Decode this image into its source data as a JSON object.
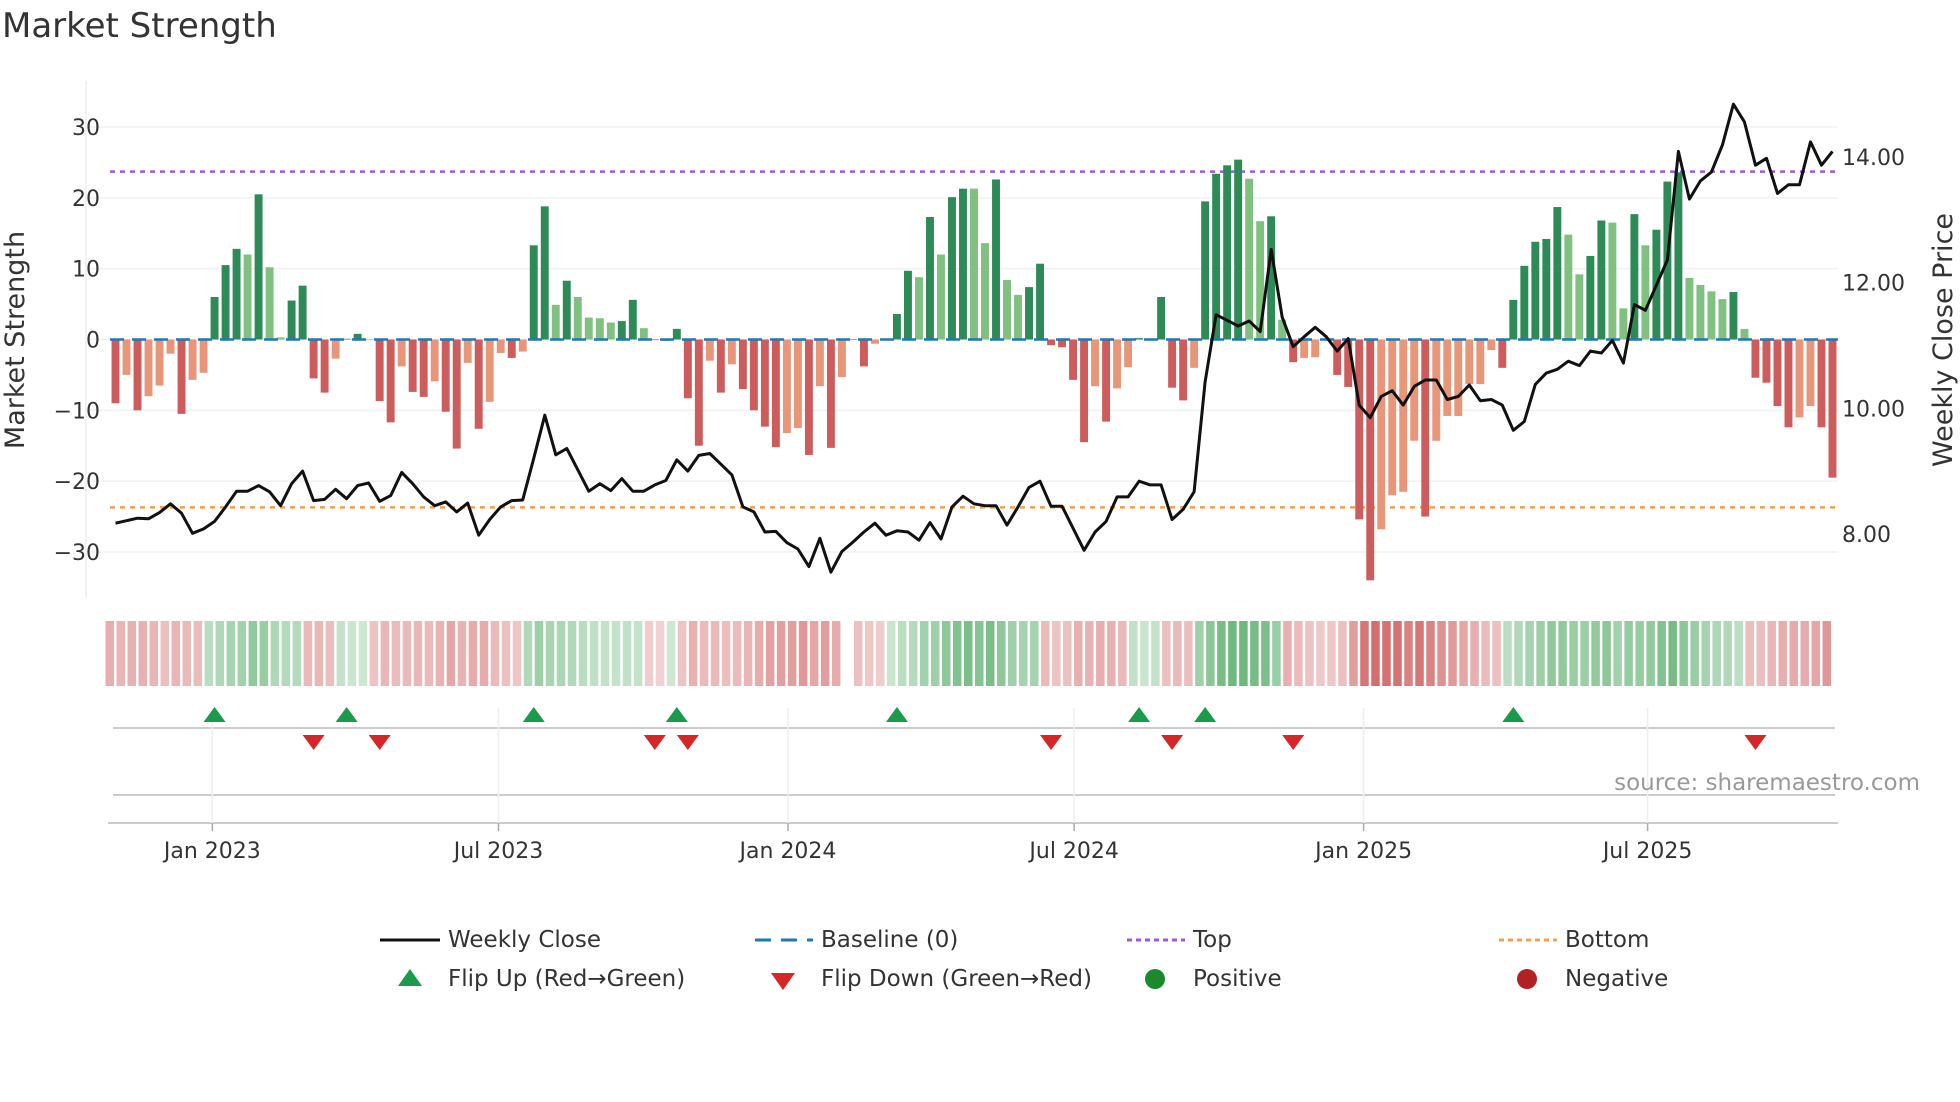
{
  "title": "Market Strength",
  "source": "source: sharemaestro.com",
  "legend": {
    "weekly_close": "Weekly Close",
    "baseline": "Baseline (0)",
    "top": "Top",
    "bottom": "Bottom",
    "flip_up": "Flip Up (Red→Green)",
    "flip_down": "Flip Down (Green→Red)",
    "positive": "Positive",
    "negative": "Negative"
  },
  "colors": {
    "pos_strong": "#2e8b57",
    "pos_weak": "#80c080",
    "neg_strong": "#cd5c5c",
    "neg_weak": "#e8967a",
    "baseline": "#1f77b4",
    "top": "#9b59e0",
    "bottom": "#f0a050",
    "price": "#111111",
    "flip_up": "#1a9a4a",
    "flip_down": "#d62728"
  },
  "chart_data": {
    "type": "bar",
    "title": "Market Strength",
    "ylabel": "Market Strength",
    "y2label": "Weekly Close Price",
    "ylim": [
      -36.5,
      36.5
    ],
    "y2lim": [
      6.98,
      15.21
    ],
    "yticks": [
      "30",
      "20",
      "10",
      "0",
      "−10",
      "−20",
      "−30"
    ],
    "ytick_values": [
      30,
      20,
      10,
      0,
      -10,
      -20,
      -30
    ],
    "y2ticks": [
      "14.00",
      "12.00",
      "10.00",
      "8.00"
    ],
    "y2tick_values": [
      14,
      12,
      10,
      8
    ],
    "xticks": [
      "Jan 2023",
      "Jul 2023",
      "Jan 2024",
      "Jul 2024",
      "Jan 2025",
      "Jul 2025"
    ],
    "xtick_weeks": [
      9.8,
      35.8,
      62.1,
      88.1,
      114.4,
      140.2
    ],
    "start_week": "2022-11-04",
    "frequency": "weekly",
    "top_level": 23.7,
    "bottom_level": -23.7,
    "baseline": 0,
    "strength": [
      -9,
      -5,
      -10,
      -8,
      -6.5,
      -2,
      -10.5,
      -5.7,
      -4.7,
      6,
      10.5,
      12.8,
      12,
      20.5,
      10.2,
      0.3,
      5.5,
      7.6,
      -5.5,
      -7.5,
      -2.7,
      0.1,
      0.8,
      0.05,
      -8.7,
      -11.7,
      -3.8,
      -7.4,
      -8.1,
      -5.9,
      -10.2,
      -15.4,
      -3.3,
      -12.6,
      -8.8,
      -1.9,
      -2.6,
      -1.7,
      13.3,
      18.8,
      4.9,
      8.3,
      6,
      3.1,
      3,
      2.4,
      2.6,
      5.6,
      1.6,
      -0.1,
      -0.2,
      1.5,
      -8.3,
      -15,
      -3,
      -7.5,
      -3.5,
      -7,
      -10,
      -12.3,
      -15.2,
      -13.2,
      -12.5,
      -16.3,
      -6.6,
      -15.3,
      -5.3,
      0,
      -3.8,
      -0.6,
      -0.1,
      3.6,
      9.7,
      8.8,
      17.3,
      12,
      20.1,
      21.3,
      21.3,
      13.6,
      22.6,
      8.4,
      6.3,
      7.4,
      10.7,
      -0.8,
      -1.1,
      -5.7,
      -14.5,
      -6.6,
      -11.6,
      -6.9,
      -3.9,
      0.2,
      0.15,
      6,
      -6.8,
      -8.6,
      -4,
      19.5,
      23.4,
      24.6,
      25.4,
      22.7,
      16.7,
      17.4,
      2.8,
      -3.2,
      -2.6,
      -2.5,
      -0.1,
      -5,
      -6.7,
      -25.4,
      -34,
      -26.8,
      -22,
      -21.5,
      -14.3,
      -25,
      -14.3,
      -10.8,
      -10.8,
      -6.3,
      -6.3,
      -1.5,
      -4,
      5.6,
      10.4,
      13.8,
      14.2,
      18.7,
      14.8,
      9.2,
      11.8,
      16.8,
      16.5,
      4.4,
      17.7,
      13.3,
      15.5,
      22.3,
      23.6,
      8.7,
      7.7,
      6.8,
      5.7,
      6.7,
      1.5,
      -5.4,
      -6.1,
      -9.4,
      -12.4,
      -11,
      -9.4,
      -12.4,
      -19.5
    ],
    "weekly_close": [
      8.17,
      8.21,
      8.25,
      8.24,
      8.34,
      8.48,
      8.33,
      8.01,
      8.08,
      8.2,
      8.43,
      8.68,
      8.68,
      8.77,
      8.67,
      8.45,
      8.8,
      9.0,
      8.53,
      8.55,
      8.71,
      8.56,
      8.77,
      8.81,
      8.52,
      8.61,
      8.98,
      8.8,
      8.59,
      8.45,
      8.51,
      8.35,
      8.49,
      7.98,
      8.23,
      8.43,
      8.53,
      8.54,
      9.2,
      9.89,
      9.26,
      9.36,
      9.02,
      8.68,
      8.8,
      8.69,
      8.88,
      8.68,
      8.68,
      8.78,
      8.85,
      9.18,
      9.0,
      9.25,
      9.28,
      9.11,
      8.94,
      8.43,
      8.35,
      8.03,
      8.04,
      7.86,
      7.76,
      7.48,
      7.93,
      7.39,
      7.72,
      7.87,
      8.03,
      8.17,
      7.98,
      8.05,
      8.03,
      7.9,
      8.18,
      7.92,
      8.43,
      8.6,
      8.48,
      8.45,
      8.45,
      8.14,
      8.43,
      8.74,
      8.84,
      8.44,
      8.44,
      8.09,
      7.74,
      8.03,
      8.2,
      8.59,
      8.59,
      8.84,
      8.78,
      8.78,
      8.23,
      8.39,
      8.67,
      10.42,
      11.49,
      11.4,
      11.31,
      11.39,
      11.22,
      12.53,
      11.45,
      10.98,
      11.14,
      11.29,
      11.14,
      10.91,
      11.11,
      10.05,
      9.85,
      10.19,
      10.28,
      10.05,
      10.35,
      10.45,
      10.45,
      10.14,
      10.19,
      10.37,
      10.12,
      10.14,
      10.05,
      9.65,
      9.79,
      10.38,
      10.56,
      10.62,
      10.75,
      10.68,
      10.91,
      10.88,
      11.08,
      10.72,
      11.65,
      11.56,
      11.96,
      12.36,
      14.09,
      13.33,
      13.62,
      13.76,
      14.19,
      14.84,
      14.56,
      13.87,
      13.98,
      13.42,
      13.56,
      13.56,
      14.24,
      13.87,
      14.09
    ],
    "flip_up_weeks": [
      10,
      22,
      39,
      52,
      72,
      94,
      100,
      128
    ],
    "flip_down_weeks": [
      19,
      25,
      50,
      53,
      86,
      97,
      108,
      150
    ]
  }
}
